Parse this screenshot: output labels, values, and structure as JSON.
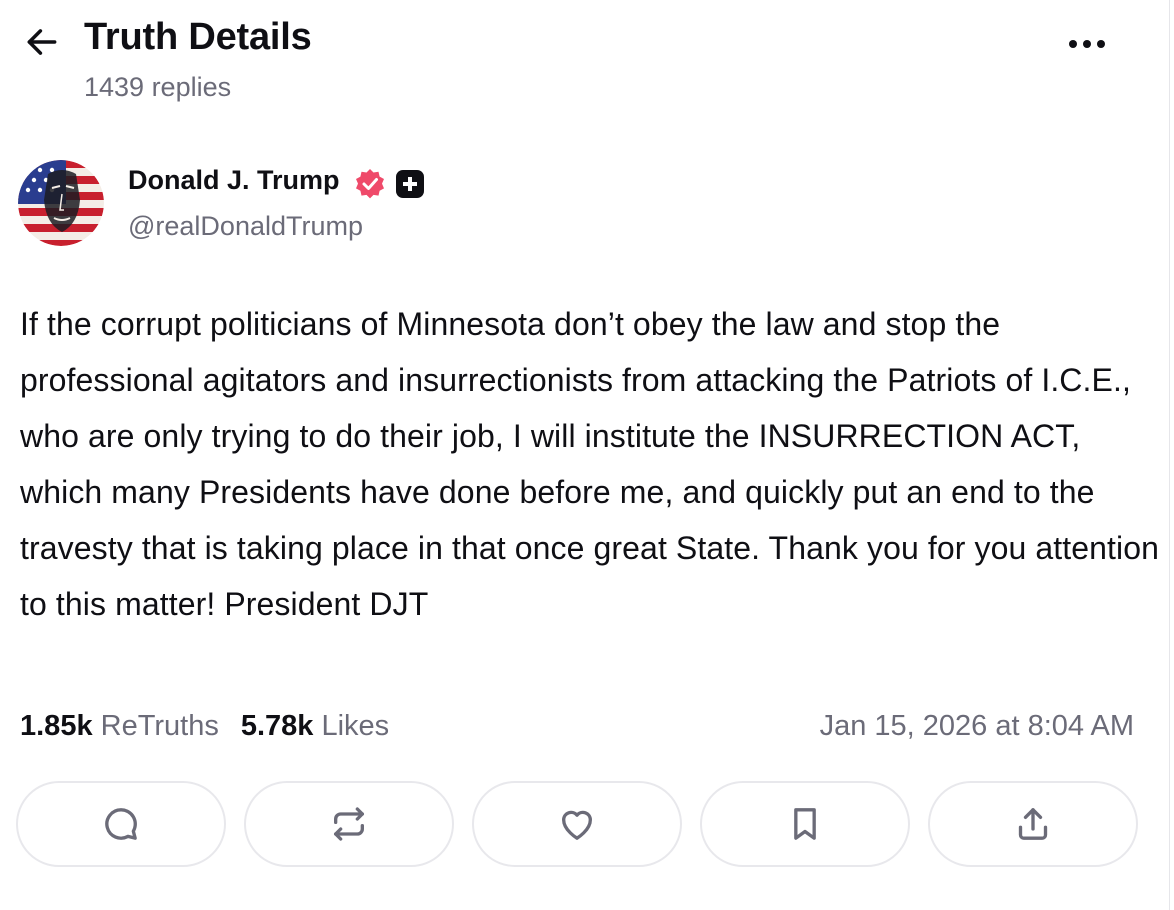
{
  "header": {
    "title": "Truth Details",
    "replies": "1439 replies",
    "back_icon": "arrow-left-icon",
    "more_icon": "ellipsis-horizontal-icon"
  },
  "author": {
    "name": "Donald J. Trump",
    "handle": "@realDonaldTrump",
    "verified_badge_color": "#ef4a6a",
    "plus_badge_color": "#0f0f14"
  },
  "post": {
    "text": "If the corrupt politicians of Minnesota don’t obey the law and stop the professional agitators and insurrectionists from attacking the Patriots of I.C.E., who are only trying to do their job, I will institute the INSURRECTION ACT, which many Presidents have done before me, and quickly put an end to the travesty that is taking place in that once great State. Thank you for you attention to this matter! President DJT",
    "retruths_count": "1.85k",
    "retruths_label": "ReTruths",
    "likes_count": "5.78k",
    "likes_label": "Likes",
    "timestamp": "Jan 15, 2026 at 8:04 AM"
  },
  "actions": [
    {
      "name": "reply",
      "icon": "comment-icon"
    },
    {
      "name": "retruth",
      "icon": "repost-icon"
    },
    {
      "name": "like",
      "icon": "heart-icon"
    },
    {
      "name": "bookmark",
      "icon": "bookmark-icon"
    },
    {
      "name": "share",
      "icon": "share-upload-icon"
    }
  ],
  "colors": {
    "text": "#0f0f14",
    "muted": "#6b6b78",
    "border": "#e8e8ec",
    "icon": "#6b6b78"
  }
}
